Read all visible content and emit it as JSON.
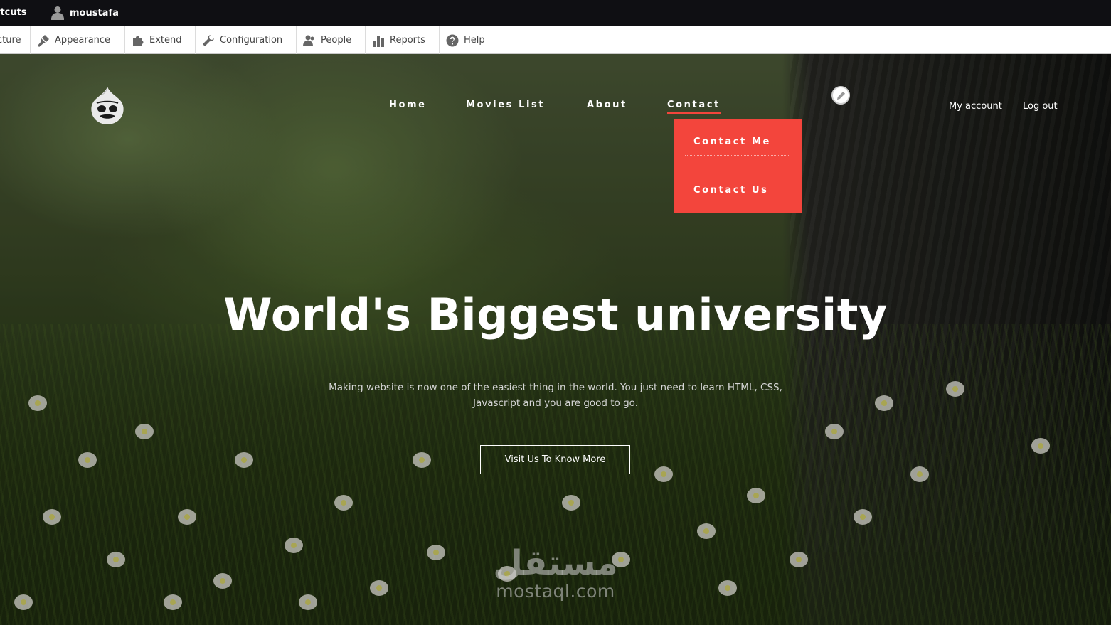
{
  "admin_bar": {
    "shortcuts_label": "rtcuts",
    "username": "moustafa"
  },
  "admin_tray": {
    "items": [
      {
        "label": "cture",
        "icon": "structure-icon"
      },
      {
        "label": "Appearance",
        "icon": "paintbrush-icon"
      },
      {
        "label": "Extend",
        "icon": "puzzle-icon"
      },
      {
        "label": "Configuration",
        "icon": "wrench-icon"
      },
      {
        "label": "People",
        "icon": "people-icon"
      },
      {
        "label": "Reports",
        "icon": "bar-chart-icon"
      },
      {
        "label": "Help",
        "icon": "question-icon"
      }
    ]
  },
  "site": {
    "nav": {
      "home": "Home",
      "movies": "Movies List",
      "about": "About",
      "contact": "Contact"
    },
    "dropdown": {
      "contact_me": "Contact Me",
      "contact_us": "Contact Us"
    },
    "account": {
      "my_account": "My account",
      "logout": "Log out"
    },
    "accent_color": "#f3453c"
  },
  "hero": {
    "headline": "World's Biggest university",
    "tagline_line1": "Making website is now one of the easiest thing in the world. You just need to learn HTML, CSS,",
    "tagline_line2": "Javascript and you are good to go.",
    "cta": "Visit Us To Know More"
  },
  "watermark": {
    "arabic": "مستقل",
    "latin": "mostaql.com"
  }
}
